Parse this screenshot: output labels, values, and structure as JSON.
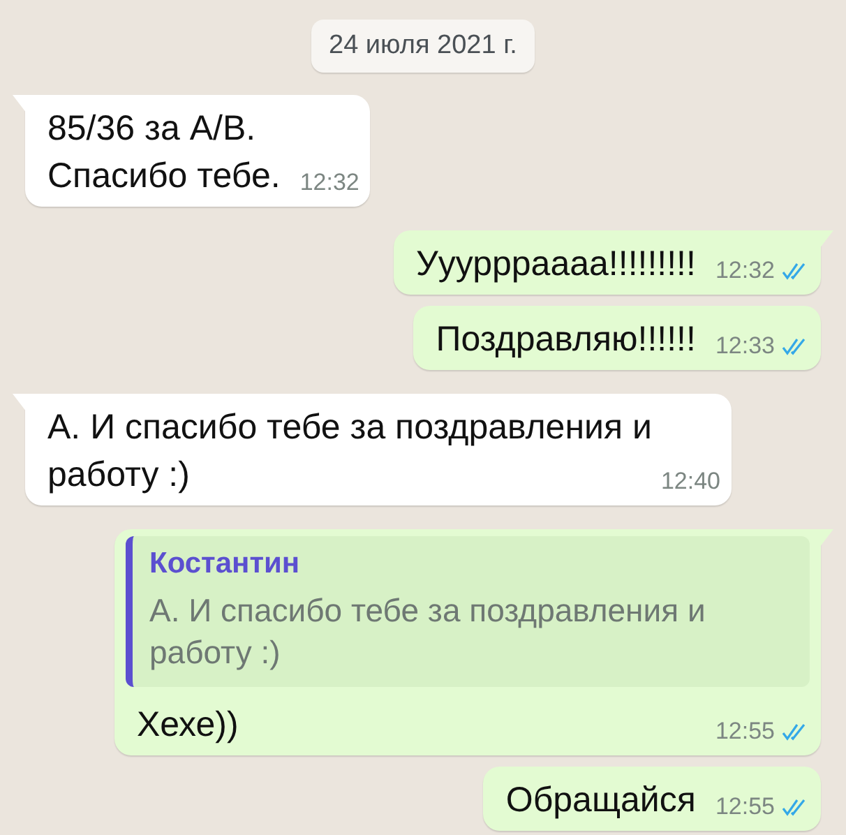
{
  "date_chip": "24 июля 2021 г.",
  "messages": [
    {
      "outgoing": false,
      "first_in_group": true,
      "text": "85/36 за А/В.\nСпасибо тебе.",
      "time": "12:32"
    },
    {
      "outgoing": true,
      "first_in_group": true,
      "text": "Уууррраааа!!!!!!!!!",
      "time": "12:32",
      "read": true
    },
    {
      "outgoing": true,
      "first_in_group": false,
      "text": "Поздравляю!!!!!!",
      "time": "12:33",
      "read": true
    },
    {
      "outgoing": false,
      "first_in_group": true,
      "text": "А. И спасибо тебе за поздравления и работу :)",
      "time": "12:40"
    },
    {
      "outgoing": true,
      "first_in_group": true,
      "quote": {
        "author": "Костантин",
        "text": "А. И спасибо тебе за поздравления и работу :)"
      },
      "text": "Хехе))",
      "time": "12:55",
      "read": true
    },
    {
      "outgoing": true,
      "first_in_group": false,
      "text": "Обращайся",
      "time": "12:55",
      "read": true
    }
  ]
}
